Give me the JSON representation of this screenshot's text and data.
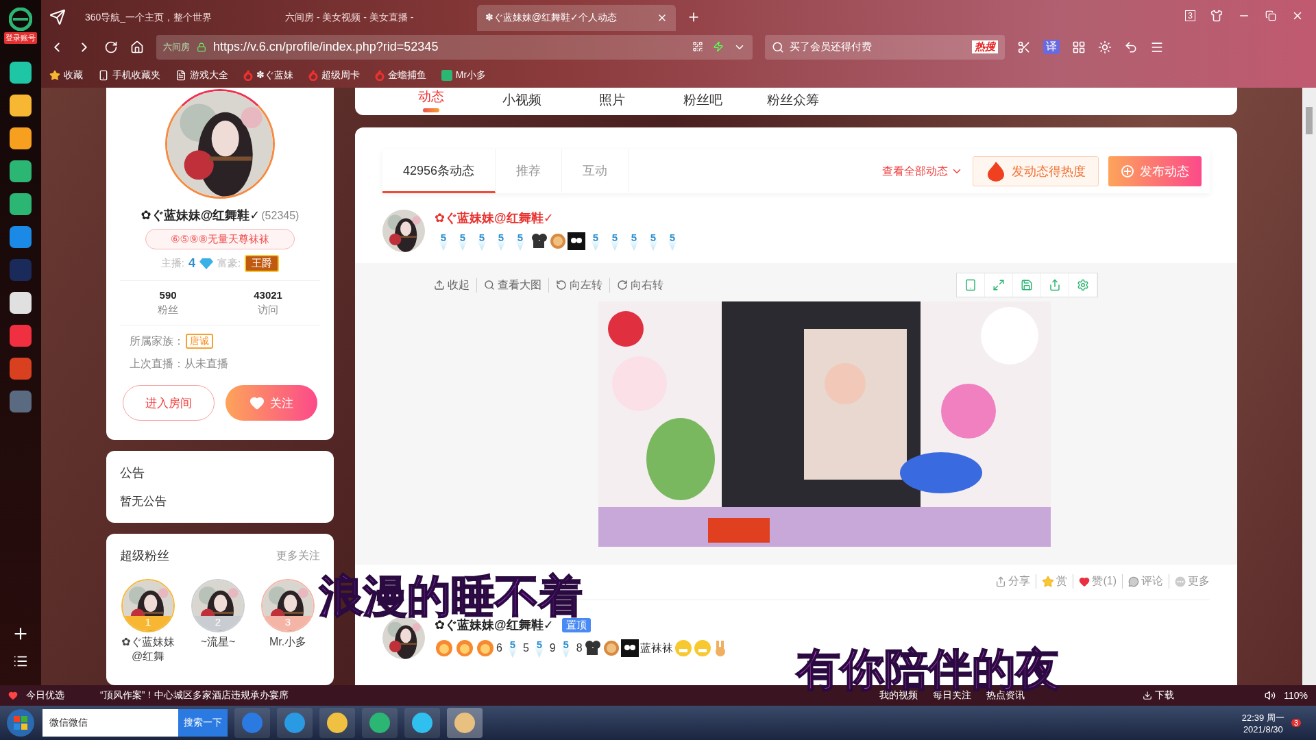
{
  "browser": {
    "side_label": "登录账号",
    "tabs": [
      {
        "title": "360导航_一个主页，整个世界",
        "selected": false
      },
      {
        "title": "六间房 - 美女视频 - 美女直播 -",
        "selected": false
      },
      {
        "title": "✽ぐ蓝妹妹@红舞鞋✓个人动态",
        "selected": true
      }
    ],
    "tab_count": "3",
    "site_badge": "六间房",
    "url": "https://v.6.cn/profile/index.php?rid=52345",
    "search_placeholder": "买了会员还得付费",
    "hot_label": "热搜",
    "translate_label": "译",
    "bookmarks": [
      {
        "label": "收藏",
        "kind": "star"
      },
      {
        "label": "手机收藏夹",
        "kind": "phone"
      },
      {
        "label": "游戏大全",
        "kind": "page"
      },
      {
        "label": "✽ぐ蓝妹",
        "kind": "six"
      },
      {
        "label": "超级周卡",
        "kind": "six"
      },
      {
        "label": "金蟾捕鱼",
        "kind": "six"
      },
      {
        "label": "Mr小多",
        "kind": "green"
      }
    ]
  },
  "page_nav": [
    {
      "label": "动态",
      "selected": true
    },
    {
      "label": "小视频",
      "selected": false
    },
    {
      "label": "照片",
      "selected": false
    },
    {
      "label": "粉丝吧",
      "selected": false
    },
    {
      "label": "粉丝众筹",
      "selected": false
    }
  ],
  "profile": {
    "name": "✿ぐ蓝妹妹@红舞鞋✓",
    "id": "(52345)",
    "nameplate": "⑥⑤⑨⑧无量天尊袜袜",
    "anchor_label": "主播:",
    "anchor_level": "4",
    "rich_label": "富豪:",
    "rich_badge": "王爵",
    "stats": [
      {
        "value": "590",
        "label": "粉丝"
      },
      {
        "value": "43021",
        "label": "访问"
      }
    ],
    "family_label": "所属家族：",
    "family": "唐诚",
    "last_live": "上次直播：从未直播",
    "enter_button": "进入房间",
    "follow_button": "关注"
  },
  "notice": {
    "title": "公告",
    "text": "暂无公告"
  },
  "super_fans": {
    "title": "超级粉丝",
    "more": "更多关注",
    "fans": [
      {
        "rank": "1",
        "name": "✿ぐ蓝妹妹@红舞",
        "color": "#f7b733"
      },
      {
        "rank": "2",
        "name": "~流星~",
        "color": "#c9cdd2"
      },
      {
        "rank": "3",
        "name": "Mr.小多",
        "color": "#f5b5a6"
      }
    ]
  },
  "feed": {
    "tabs": [
      {
        "label": "42956条动态",
        "selected": true
      },
      {
        "label": "推荐",
        "selected": false
      },
      {
        "label": "互动",
        "selected": false
      }
    ],
    "view_all": "查看全部动态",
    "hot_button": "发动态得热度",
    "post_button": "发布动态",
    "posts": [
      {
        "author": "✿ぐ蓝妹妹@红舞鞋✓",
        "pinned": false,
        "badges": [
          {
            "kind": "v",
            "label": "5"
          },
          {
            "kind": "v",
            "label": "5"
          },
          {
            "kind": "v",
            "label": "5"
          },
          {
            "kind": "v",
            "label": "5"
          },
          {
            "kind": "v",
            "label": "5"
          },
          {
            "kind": "film"
          },
          {
            "kind": "medal"
          },
          {
            "kind": "mask"
          },
          {
            "kind": "v",
            "label": "5"
          },
          {
            "kind": "v",
            "label": "5"
          },
          {
            "kind": "v",
            "label": "5"
          },
          {
            "kind": "v",
            "label": "5"
          },
          {
            "kind": "v",
            "label": "5"
          }
        ],
        "viewer": {
          "tools": [
            "收起",
            "查看大图",
            "向左转",
            "向右转"
          ]
        },
        "actions": [
          "分享",
          "赏",
          "赞(1)",
          "评论",
          "更多"
        ]
      },
      {
        "author": "✿ぐ蓝妹妹@红舞鞋✓",
        "pinned": true,
        "pinned_label": "置顶",
        "badges": [
          {
            "kind": "flower"
          },
          {
            "kind": "flower"
          },
          {
            "kind": "flower"
          },
          {
            "kind": "text",
            "label": "6"
          },
          {
            "kind": "v",
            "label": "5"
          },
          {
            "kind": "text",
            "label": "5"
          },
          {
            "kind": "v",
            "label": "5"
          },
          {
            "kind": "text",
            "label": "9"
          },
          {
            "kind": "v",
            "label": "5"
          },
          {
            "kind": "text",
            "label": "8"
          },
          {
            "kind": "film"
          },
          {
            "kind": "medal"
          },
          {
            "kind": "mask"
          },
          {
            "kind": "text",
            "label": "蓝袜袜"
          },
          {
            "kind": "grin"
          },
          {
            "kind": "grin"
          },
          {
            "kind": "peace"
          }
        ]
      }
    ]
  },
  "lyrics": [
    "浪漫的睡不着",
    "有你陪伴的夜"
  ],
  "status_bar": {
    "promo": "今日优选",
    "news": "“顶风作案”！中心城区多家酒店违规承办宴席",
    "links": [
      "我的视频",
      "每日关注",
      "热点资讯"
    ],
    "download": "下载",
    "zoom": "110%"
  },
  "taskbar": {
    "search_value": "微信微信",
    "search_button": "搜索一下",
    "time": "22:39 周一",
    "date": "2021/8/30",
    "notifications": "3"
  }
}
